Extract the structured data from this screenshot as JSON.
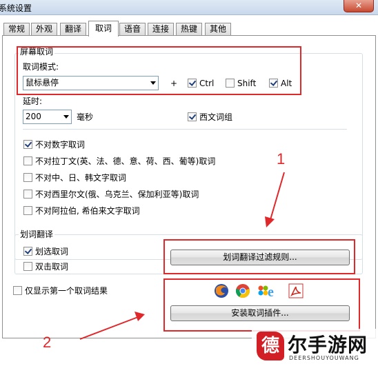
{
  "window": {
    "title": "系统设置",
    "close_label": "✕"
  },
  "tabs": [
    {
      "label": "常规"
    },
    {
      "label": "外观"
    },
    {
      "label": "翻译"
    },
    {
      "label": "取词"
    },
    {
      "label": "语音"
    },
    {
      "label": "连接"
    },
    {
      "label": "热键"
    },
    {
      "label": "其他"
    }
  ],
  "screen_capture": {
    "group_label": "屏幕取词",
    "mode_label": "取词模式:",
    "mode_value": "鼠标悬停",
    "plus": "+",
    "ctrl_label": "Ctrl",
    "ctrl_checked": true,
    "shift_label": "Shift",
    "shift_checked": false,
    "alt_label": "Alt",
    "alt_checked": true,
    "delay_label": "延时:",
    "delay_value": "200",
    "delay_unit": "毫秒",
    "western_phrase_label": "西文词组",
    "western_phrase_checked": true,
    "exclusions": [
      {
        "label": "不对数字取词",
        "checked": true
      },
      {
        "label": "不对拉丁文(英、法、德、意、荷、西、葡等)取词",
        "checked": false
      },
      {
        "label": "不对中、日、韩文字取词",
        "checked": false
      },
      {
        "label": "不对西里尔文(俄、乌克兰、保加利亚等)取词",
        "checked": false
      },
      {
        "label": "不对阿拉伯, 希伯来文字取词",
        "checked": false
      }
    ]
  },
  "select_translate": {
    "group_label": "划词翻译",
    "select_label": "划选取词",
    "select_checked": true,
    "dblclick_label": "双击取词",
    "dblclick_checked": false,
    "filter_button": "划词翻译过滤规则..."
  },
  "first_result_only": {
    "label": "仅显示第一个取词结果",
    "checked": false
  },
  "plugins": {
    "install_button": "安装取词插件...",
    "icons": [
      "firefox-icon",
      "chrome-icon",
      "ie-icon",
      "acrobat-icon"
    ]
  },
  "annotations": {
    "one": "1",
    "two": "2"
  },
  "watermark": {
    "seal": "德",
    "text": "尔手游网",
    "sub": "DEERSHOUYOUWANG"
  },
  "colors": {
    "annotation_red": "#e0272a",
    "seal_red": "#d21f25"
  }
}
